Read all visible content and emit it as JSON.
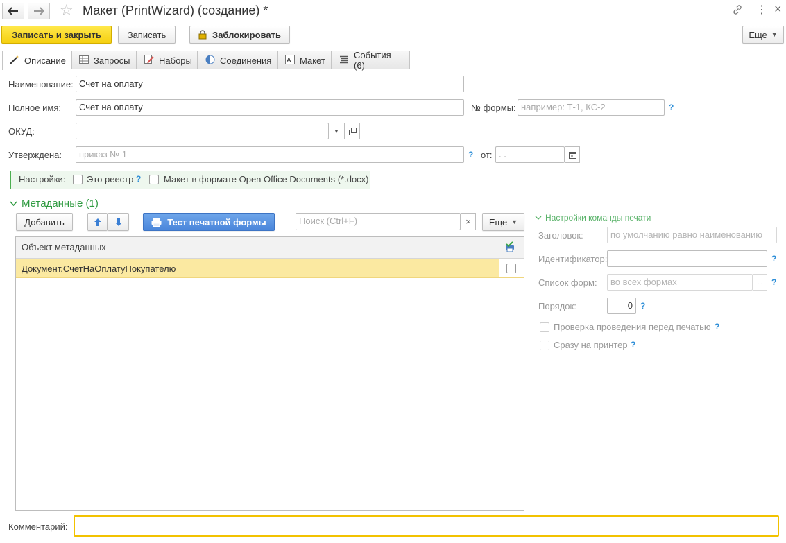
{
  "window": {
    "title": "Макет (PrintWizard) (создание) *",
    "back_icon": "arrow-left-icon",
    "forward_icon": "arrow-right-icon",
    "favorite_icon": "star-icon",
    "link_icon": "link-icon",
    "menu_icon": "kebab-icon",
    "close_glyph": "×"
  },
  "toolbar": {
    "save_close_label": "Записать и закрыть",
    "save_label": "Записать",
    "lock_label": "Заблокировать",
    "more_label": "Еще"
  },
  "tabs": [
    {
      "label": "Описание",
      "icon": "wand-icon",
      "active": true
    },
    {
      "label": "Запросы",
      "icon": "table-icon"
    },
    {
      "label": "Наборы",
      "icon": "edit-icon"
    },
    {
      "label": "Соединения",
      "icon": "circle-half-icon"
    },
    {
      "label": "Макет",
      "icon": "layout-icon"
    },
    {
      "label": "События (6)",
      "icon": "list-icon"
    }
  ],
  "form": {
    "name_label": "Наименование:",
    "name_value": "Счет на оплату",
    "fullname_label": "Полное имя:",
    "fullname_value": "Счет на оплату",
    "formno_label": "№ формы:",
    "formno_placeholder": "например: Т-1, КС-2",
    "okud_label": "ОКУД:",
    "okud_value": "",
    "approved_label": "Утверждена:",
    "approved_placeholder": "приказ № 1",
    "from_label": "от:",
    "date_value": " .  .",
    "settings_label": "Настройки:",
    "registry_label": "Это реестр",
    "docx_label": "Макет в формате Open Office Documents (*.docx)",
    "help": "?",
    "comment_label": "Комментарий:",
    "comment_value": ""
  },
  "metadata": {
    "title": "Метаданные (1)",
    "add_label": "Добавить",
    "test_label": "Тест печатной формы",
    "search_placeholder": "Поиск (Ctrl+F)",
    "clear_glyph": "×",
    "more_label": "Еще",
    "column_header": "Объект метаданных",
    "rows": [
      {
        "object": "Документ.СчетНаОплатуПокупателю",
        "checked": false
      }
    ]
  },
  "print_settings": {
    "title": "Настройки команды печати",
    "caption_label": "Заголовок:",
    "caption_placeholder": "по умолчанию равно наименованию",
    "id_label": "Идентификатор:",
    "forms_label": "Список форм:",
    "forms_placeholder": "во всех формах",
    "order_label": "Порядок:",
    "order_value": "0",
    "check_label": "Проверка проведения перед печатью",
    "printer_label": "Сразу на принтер",
    "ellipsis": "..."
  },
  "colors": {
    "primary": "#f5d010",
    "group_green": "#2d9a3f",
    "selection": "#fbe9a1",
    "comment_border": "#f2c200",
    "help_blue": "#2f8fd8"
  }
}
